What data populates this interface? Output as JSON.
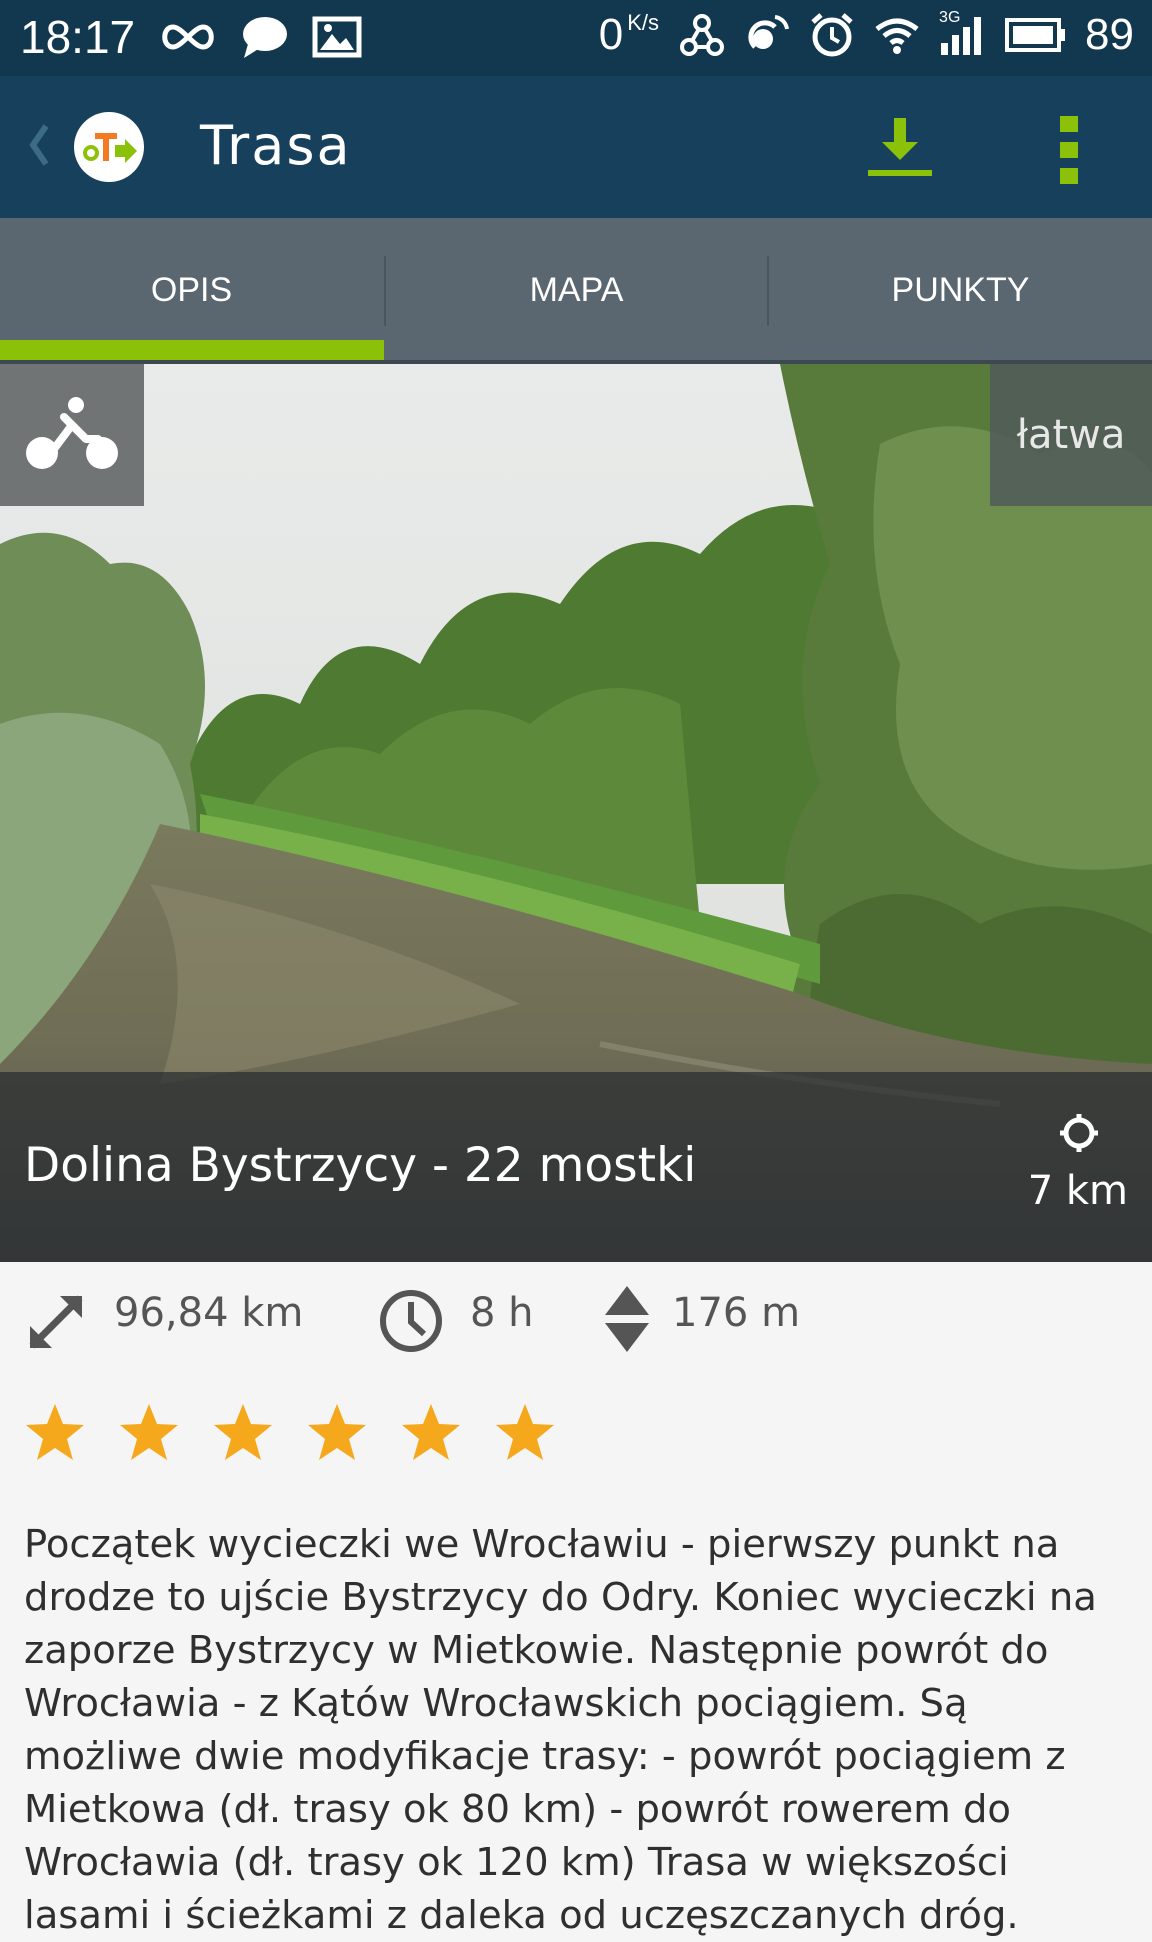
{
  "status_bar": {
    "time": "18:17",
    "net_speed_value": "0",
    "net_speed_unit": "K/s",
    "network_type": "3G",
    "battery": "89",
    "icons": [
      "infinity-icon",
      "chat-bubble-icon",
      "image-icon",
      "usb-share-icon",
      "hotspot-icon",
      "alarm-icon",
      "wifi-icon",
      "signal-icon",
      "battery-icon"
    ]
  },
  "app_bar": {
    "title": "Trasa",
    "icons": [
      "back-chevron-icon",
      "app-logo-icon",
      "download-icon",
      "more-vert-icon"
    ]
  },
  "tabs": [
    {
      "label": "OPIS",
      "active": true
    },
    {
      "label": "MAPA",
      "active": false
    },
    {
      "label": "PUNKTY",
      "active": false
    }
  ],
  "hero": {
    "activity_icon": "bicycle-icon",
    "difficulty": "łatwa",
    "route_name": "Dolina Bystrzycy - 22 mostki",
    "distance_from_user": "7 km",
    "location_icon": "target-location-icon"
  },
  "stats": {
    "length": "96,84 km",
    "duration": "8 h",
    "elevation": "176 m",
    "icons": [
      "resize-arrow-icon",
      "clock-icon",
      "elevation-icon"
    ]
  },
  "rating": {
    "stars": 6,
    "max": 6
  },
  "description": "Początek wycieczki we Wrocławiu - pierwszy punkt na drodze to ujście Bystrzycy do Odry. Koniec wycieczki na zaporze Bystrzycy w Mietkowie. Następnie powrót do Wrocławia - z Kątów Wrocławskich pociągiem. Są możliwe dwie modyfikacje trasy: - powrót pociągiem z Mietkowa (dł. trasy ok 80 km) - powrót rowerem do Wrocławia (dł. trasy ok 120 km) Trasa w większości lasami i ścieżkami z daleka od uczęszczanych dróg.",
  "colors": {
    "status_bar": "#12384f",
    "app_bar": "#16405b",
    "tabs": "#5a6670",
    "accent": "#8cc10a",
    "star": "#f5a81c"
  }
}
